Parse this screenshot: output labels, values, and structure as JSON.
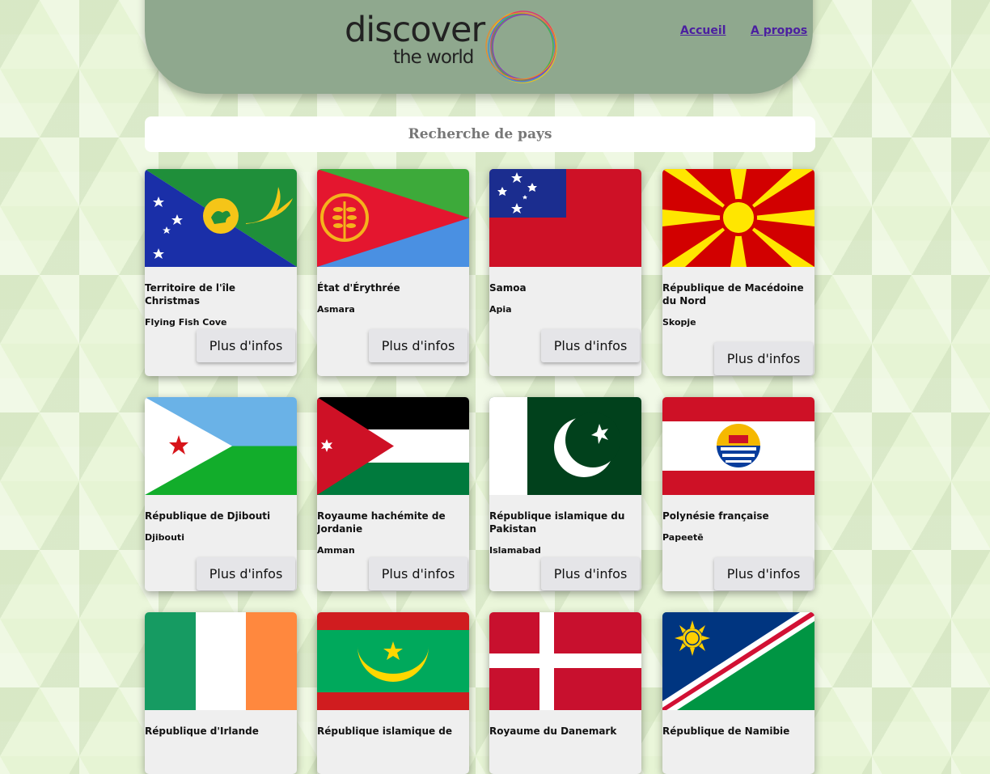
{
  "header": {
    "logo_line1": "discover",
    "logo_line2": "the world",
    "nav": [
      {
        "label": "Accueil"
      },
      {
        "label": "A propos"
      }
    ]
  },
  "search": {
    "label": "Recherche de pays"
  },
  "colors": {
    "header": "#8fa88e",
    "nav_link": "#4b1fa0",
    "card": "#efefef"
  },
  "countries": [
    {
      "name": "Territoire de l'île Christmas",
      "capital": "Flying Fish Cove",
      "button": "Plus d'infos",
      "flag": "christmas-island-flag"
    },
    {
      "name": "État d'Érythrée",
      "capital": "Asmara",
      "button": "Plus d'infos",
      "flag": "eritrea-flag"
    },
    {
      "name": "Samoa",
      "capital": "Apia",
      "button": "Plus d'infos",
      "flag": "samoa-flag"
    },
    {
      "name": "République de Macédoine du Nord",
      "capital": "Skopje",
      "button": "Plus d'infos",
      "flag": "north-macedonia-flag"
    },
    {
      "name": "République de Djibouti",
      "capital": "Djibouti",
      "button": "Plus d'infos",
      "flag": "djibouti-flag"
    },
    {
      "name": "Royaume hachémite de Jordanie",
      "capital": "Amman",
      "button": "Plus d'infos",
      "flag": "jordan-flag"
    },
    {
      "name": "République islamique du Pakistan",
      "capital": "Islamabad",
      "button": "Plus d'infos",
      "flag": "pakistan-flag"
    },
    {
      "name": "Polynésie française",
      "capital": "Papeetē",
      "button": "Plus d'infos",
      "flag": "french-polynesia-flag"
    },
    {
      "name": "République d'Irlande",
      "flag": "ireland-flag"
    },
    {
      "name": "République islamique de",
      "flag": "mauritania-flag"
    },
    {
      "name": "Royaume du Danemark",
      "flag": "denmark-flag"
    },
    {
      "name": "République de Namibie",
      "flag": "namibia-flag"
    }
  ]
}
